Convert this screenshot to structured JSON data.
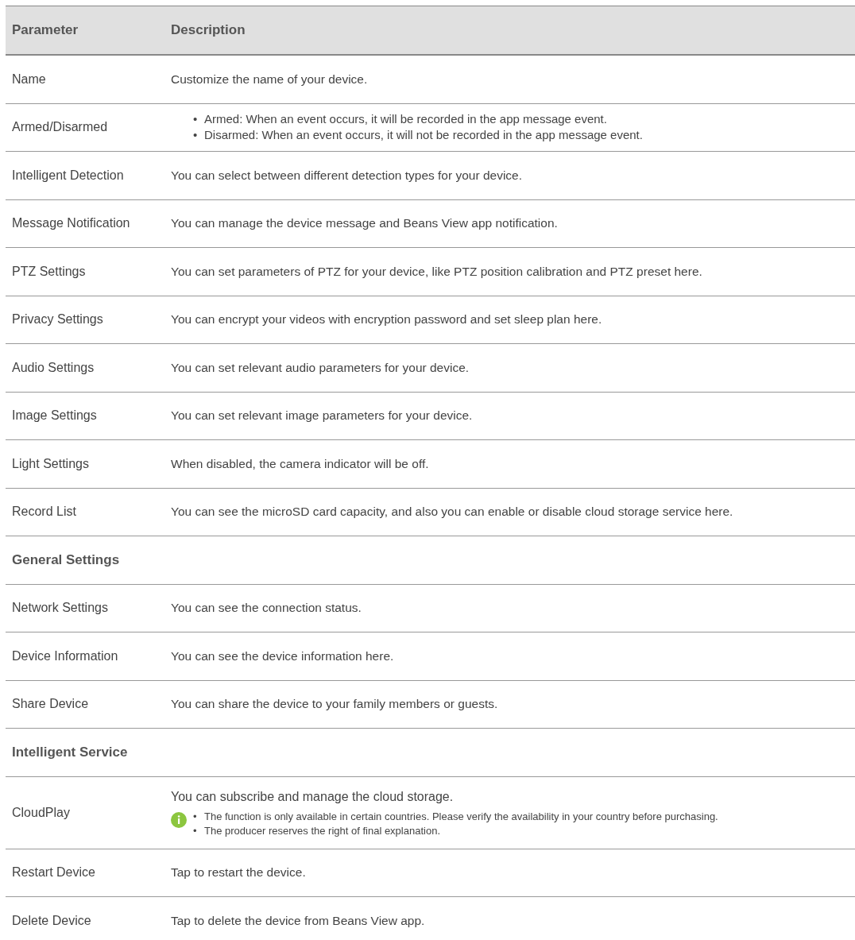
{
  "table": {
    "columns": [
      "Parameter",
      "Description"
    ],
    "rows": [
      {
        "kind": "item",
        "parameter": "Name",
        "description": "Customize the name of your device."
      },
      {
        "kind": "bullets",
        "parameter": "Armed/Disarmed",
        "bullets": [
          {
            "marker": "•",
            "text": "Armed: When an event occurs, it will be recorded in the app message event."
          },
          {
            "marker": "•",
            "text": "Disarmed: When an event occurs, it will not be recorded in the app message event."
          }
        ]
      },
      {
        "kind": "item",
        "parameter": "Intelligent Detection",
        "description": "You can select between different detection types for your device."
      },
      {
        "kind": "item",
        "parameter": "Message Notification",
        "description": "You can manage the device message and Beans View app notification."
      },
      {
        "kind": "item",
        "parameter": "PTZ Settings",
        "description": "You can set parameters of PTZ for your device, like PTZ position calibration and PTZ preset here."
      },
      {
        "kind": "item",
        "parameter": "Privacy Settings",
        "description": "You can encrypt your videos with encryption password and set sleep plan here."
      },
      {
        "kind": "item",
        "parameter": "Audio Settings",
        "description": "You can set relevant audio parameters for your device."
      },
      {
        "kind": "item",
        "parameter": "Image Settings",
        "description": "You can set relevant image parameters for your device."
      },
      {
        "kind": "item",
        "parameter": "Light Settings",
        "description": "When disabled, the camera indicator will be off."
      },
      {
        "kind": "item",
        "parameter": "Record List",
        "description": "You can see the microSD card capacity, and also you can enable or disable cloud storage service here."
      },
      {
        "kind": "section",
        "title": "General Settings"
      },
      {
        "kind": "item",
        "parameter": "Network Settings",
        "description": "You can see the connection status."
      },
      {
        "kind": "item",
        "parameter": "Device Information",
        "description": "You can see the device information here."
      },
      {
        "kind": "item",
        "parameter": "Share Device",
        "description": "You can share the device to your family members or guests."
      },
      {
        "kind": "section",
        "title": "Intelligent Service"
      },
      {
        "kind": "note",
        "parameter": "CloudPlay",
        "description": "You can subscribe and manage the cloud storage.",
        "notes": [
          {
            "marker": "•",
            "text": "The function is only available in certain countries. Please verify the availability in your country before purchasing."
          },
          {
            "marker": "•",
            "text": "The producer reserves the right of final explanation."
          }
        ]
      },
      {
        "kind": "item",
        "parameter": "Restart Device",
        "description": "Tap to restart the device."
      },
      {
        "kind": "item",
        "parameter": "Delete Device",
        "description": "Tap to delete the device from Beans View app."
      }
    ]
  }
}
